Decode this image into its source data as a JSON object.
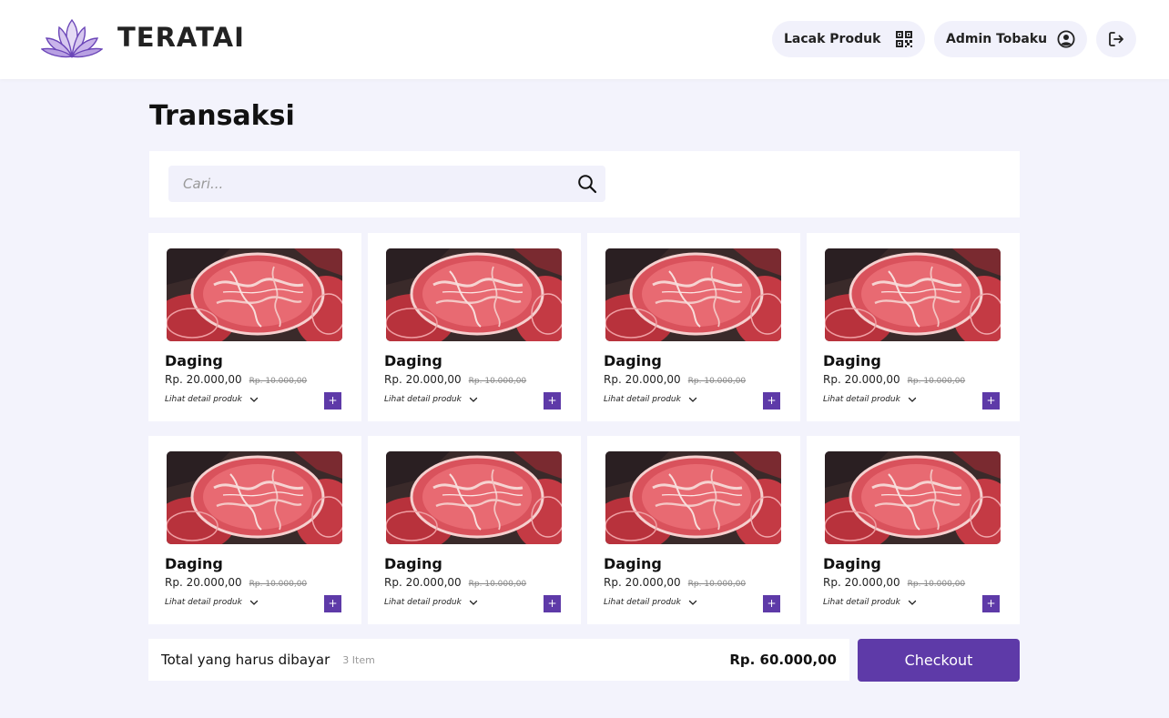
{
  "header": {
    "brand": "TERATAI",
    "track_label": "Lacak Produk",
    "user_label": "Admin Tobaku"
  },
  "page": {
    "title": "Transaksi"
  },
  "search": {
    "placeholder": "Cari..."
  },
  "products": [
    {
      "name": "Daging",
      "price": "Rp. 20.000,00",
      "old_price": "Rp. 10.000,00",
      "detail": "Lihat detail produk",
      "add": "+"
    },
    {
      "name": "Daging",
      "price": "Rp. 20.000,00",
      "old_price": "Rp. 10.000,00",
      "detail": "Lihat detail produk",
      "add": "+"
    },
    {
      "name": "Daging",
      "price": "Rp. 20.000,00",
      "old_price": "Rp. 10.000,00",
      "detail": "Lihat detail produk",
      "add": "+"
    },
    {
      "name": "Daging",
      "price": "Rp. 20.000,00",
      "old_price": "Rp. 10.000,00",
      "detail": "Lihat detail produk",
      "add": "+"
    },
    {
      "name": "Daging",
      "price": "Rp. 20.000,00",
      "old_price": "Rp. 10.000,00",
      "detail": "Lihat detail produk",
      "add": "+"
    },
    {
      "name": "Daging",
      "price": "Rp. 20.000,00",
      "old_price": "Rp. 10.000,00",
      "detail": "Lihat detail produk",
      "add": "+"
    },
    {
      "name": "Daging",
      "price": "Rp. 20.000,00",
      "old_price": "Rp. 10.000,00",
      "detail": "Lihat detail produk",
      "add": "+"
    },
    {
      "name": "Daging",
      "price": "Rp. 20.000,00",
      "old_price": "Rp. 10.000,00",
      "detail": "Lihat detail produk",
      "add": "+"
    }
  ],
  "footer": {
    "total_label": "Total yang harus dibayar",
    "item_count": "3 Item",
    "total_amount": "Rp. 60.000,00",
    "checkout_label": "Checkout"
  },
  "icons": {
    "logo": "lotus-logo-icon",
    "track": "qr-code-icon",
    "user": "user-circle-icon",
    "logout": "logout-icon",
    "search": "search-icon",
    "detail": "chevron-down-icon"
  },
  "colors": {
    "accent": "#5e3aa8",
    "background": "#f3f3fc",
    "pill": "#f1f1fb"
  }
}
